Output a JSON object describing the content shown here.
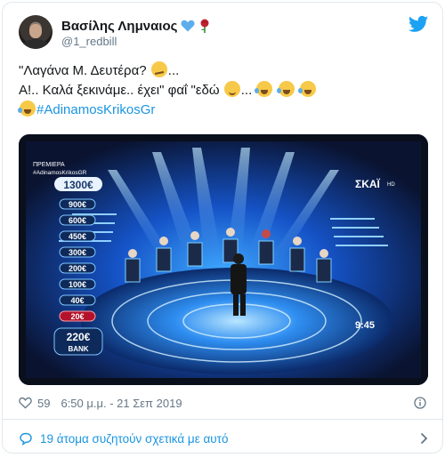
{
  "user": {
    "display_name": "Βασίλης Λημναιος",
    "handle": "@1_redbill"
  },
  "tweet": {
    "line1": "\"Λαγάνα Μ. Δευτέρα? ",
    "line1_end": "...",
    "line2": "Α!.. Καλά ξεκινάμε.. έχει\" φαΐ \"εδώ ",
    "line2_mid": "...",
    "hashtag": "#AdinamosKrikosGr"
  },
  "media": {
    "premiere_label": "ΠΡΕΜΙΕΡΑ",
    "hashtag_overlay": "#AdinamosKrikosGR",
    "money_ladder": [
      "1300€",
      "900€",
      "600€",
      "450€",
      "300€",
      "200€",
      "100€",
      "40€",
      "20€"
    ],
    "bank_amount": "220€",
    "bank_label": "BANK",
    "channel_logo": "ΣΚΑΪ",
    "channel_hd": "HD",
    "clock": "9:45"
  },
  "footer": {
    "likes": "59",
    "timestamp": "6:50 μ.μ. - 21 Σεπ 2019",
    "conversation": "19 άτομα συζητούν σχετικά με αυτό"
  },
  "colors": {
    "link": "#1b95e0",
    "heart": "#5dadec",
    "bird": "#1da1f2",
    "rose": "#c0212f"
  },
  "icons": [
    "blue-heart-icon",
    "rose-icon",
    "twitter-bird-icon",
    "thinking-face-icon",
    "winking-face-icon",
    "tears-of-joy-icon",
    "heart-like-icon",
    "info-icon",
    "speech-bubble-icon",
    "chevron-right-icon"
  ]
}
